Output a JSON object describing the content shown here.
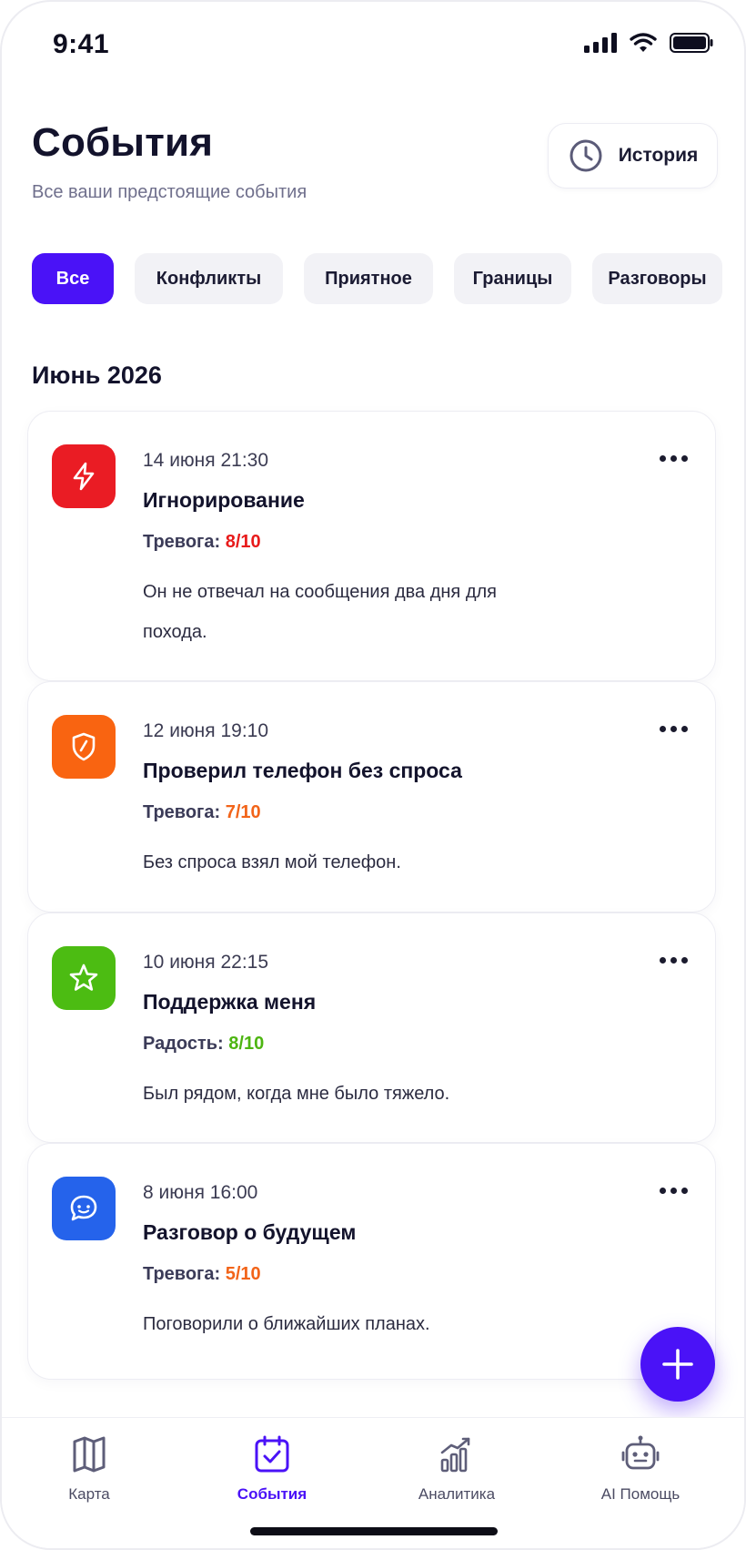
{
  "status_bar": {
    "time": "9:41"
  },
  "header": {
    "title": "События",
    "subtitle": "Все ваши предстоящие события",
    "history_label": "История"
  },
  "filters": [
    {
      "label": "Все",
      "active": true
    },
    {
      "label": "Конфликты",
      "active": false
    },
    {
      "label": "Приятное",
      "active": false
    },
    {
      "label": "Границы",
      "active": false
    },
    {
      "label": "Разговоры",
      "active": false
    }
  ],
  "section": {
    "month": "Июнь 2026"
  },
  "events": [
    {
      "date": "14 июня 21:30",
      "title": "Игнорирование",
      "level_label": "Тревога:",
      "level_value": "8/10",
      "level_color": "#e81b1b",
      "description": "Он не отвечал на сообщения два дня для похода.",
      "icon": "lightning-icon",
      "icon_color": "#ea1c24"
    },
    {
      "date": "12 июня 19:10",
      "title": "Проверил телефон без спроса",
      "level_label": "Тревога:",
      "level_value": "7/10",
      "level_color": "#f26419",
      "description": "Без спроса взял мой телефон.",
      "icon": "shield-icon",
      "icon_color": "#f96411"
    },
    {
      "date": "10 июня 22:15",
      "title": "Поддержка меня",
      "level_label": "Радость:",
      "level_value": "8/10",
      "level_color": "#4db511",
      "description": "Был рядом, когда мне было тяжело.",
      "icon": "star-icon",
      "icon_color": "#4cbc12"
    },
    {
      "date": "8 июня 16:00",
      "title": "Разговор о будущем",
      "level_label": "Тревога:",
      "level_value": "5/10",
      "level_color": "#f26419",
      "description": "Поговорили о ближайших планах.",
      "icon": "chat-icon",
      "icon_color": "#2563eb"
    }
  ],
  "tabs": [
    {
      "label": "Карта",
      "icon": "map-icon",
      "active": false
    },
    {
      "label": "События",
      "icon": "calendar-check-icon",
      "active": true
    },
    {
      "label": "Аналитика",
      "icon": "analytics-icon",
      "active": false
    },
    {
      "label": "AI Помощь",
      "icon": "robot-icon",
      "active": false
    }
  ],
  "colors": {
    "accent": "#4a12f7"
  }
}
